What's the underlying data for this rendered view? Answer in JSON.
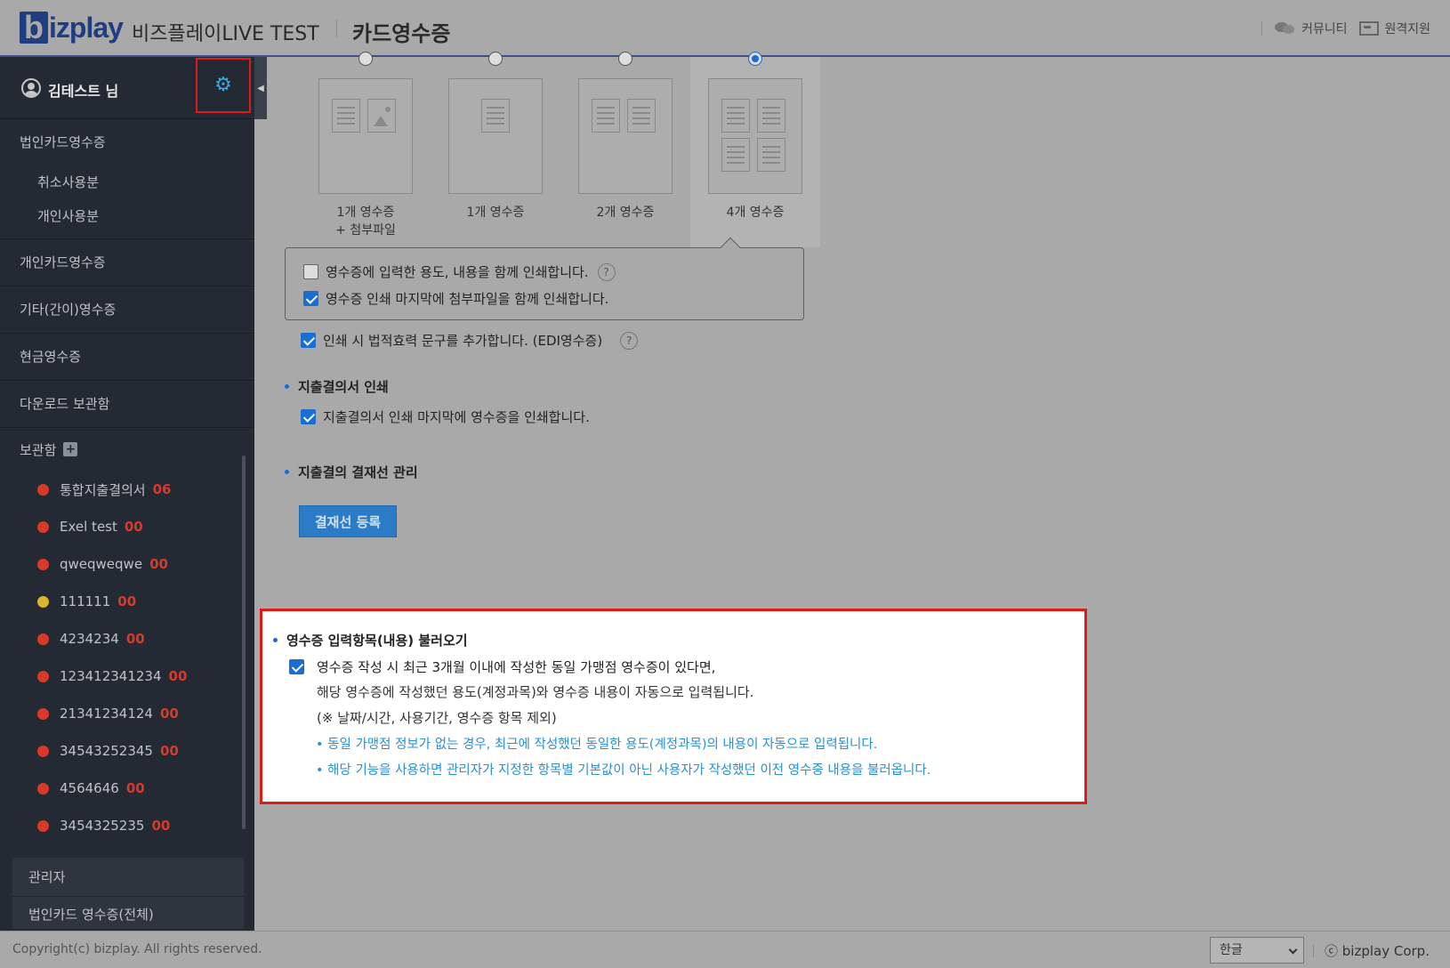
{
  "header": {
    "logo_b": "b",
    "logo_rest": "izplay",
    "app_name": "비즈플레이LIVE TEST",
    "page_title": "카드영수증",
    "links": {
      "community": "커뮤니티",
      "remote_support": "원격지원"
    }
  },
  "sidebar": {
    "user_name": "김테스트 님",
    "corp_card": {
      "label": "법인카드영수증",
      "subs": [
        "취소사용분",
        "개인사용분"
      ]
    },
    "personal_card": "개인카드영수증",
    "other_receipt": "기타(간이)영수증",
    "cash_receipt": "현금영수증",
    "download_box": "다운로드 보관함",
    "storage": {
      "label": "보관함",
      "items": [
        {
          "name": "통합지출결의서",
          "count": "06",
          "color": "#d83a2a"
        },
        {
          "name": "Exel test",
          "count": "00",
          "color": "#d83a2a"
        },
        {
          "name": "qweqweqwe",
          "count": "00",
          "color": "#d83a2a"
        },
        {
          "name": "111111",
          "count": "00",
          "color": "#d8b82a"
        },
        {
          "name": "4234234",
          "count": "00",
          "color": "#d83a2a"
        },
        {
          "name": "123412341234",
          "count": "00",
          "color": "#d83a2a"
        },
        {
          "name": "21341234124",
          "count": "00",
          "color": "#d83a2a"
        },
        {
          "name": "34543252345",
          "count": "00",
          "color": "#d83a2a"
        },
        {
          "name": "4564646",
          "count": "00",
          "color": "#d83a2a"
        },
        {
          "name": "3454325235",
          "count": "00",
          "color": "#d83a2a"
        }
      ]
    },
    "admin": {
      "label": "관리자",
      "sub": "법인카드 영수증(전체)"
    }
  },
  "main": {
    "layout_options": [
      {
        "line1": "1개 영수증",
        "line2": "+ 첨부파일",
        "selected": false
      },
      {
        "line1": "1개 영수증",
        "line2": "",
        "selected": false
      },
      {
        "line1": "2개 영수증",
        "line2": "",
        "selected": false
      },
      {
        "line1": "4개 영수증",
        "line2": "",
        "selected": true
      }
    ],
    "popup": {
      "opt1": "영수증에 입력한 용도, 내용을 함께 인쇄합니다.",
      "opt1_checked": false,
      "opt2": "영수증 인쇄 마지막에 첨부파일을 함께 인쇄합니다.",
      "opt2_checked": true
    },
    "legal_text": "인쇄 시 법적효력 문구를 추가합니다. (EDI영수증)",
    "expense_print": {
      "title": "지출결의서 인쇄",
      "option": "지출결의서 인쇄 마지막에 영수증을 인쇄합니다."
    },
    "approval_line": {
      "title": "지출결의 결재선 관리",
      "button": "결재선 등록"
    },
    "load_items": {
      "title": "영수증 입력항목(내용) 불러오기",
      "line1": "영수증 작성 시 최근 3개월 이내에 작성한 동일 가맹점 영수증이 있다면,",
      "line2": "해당 영수증에 작성했던 용도(계정과목)와 영수증 내용이 자동으로 입력됩니다.",
      "line3": "(※ 날짜/시간, 사용기간, 영수증 항목 제외)",
      "note1": "• 동일 가맹점 정보가 없는 경우, 최근에 작성했던 동일한 용도(계정과목)의 내용이 자동으로 입력됩니다.",
      "note2": "• 해당 기능을 사용하면 관리자가 지정한 항목별 기본값이 아닌 사용자가 작성했던 이전 영수증 내용을 불러옵니다."
    }
  },
  "footer": {
    "copyright": "Copyright(c) bizplay. All rights reserved.",
    "language": "한글",
    "corp": "ⓒ bizplay Corp."
  }
}
